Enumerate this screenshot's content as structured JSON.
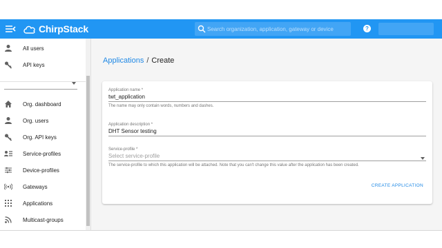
{
  "colors": {
    "appbar": "#2196f3",
    "link": "#1e88e5"
  },
  "topbar": {
    "logo_text": "ChirpStack",
    "search_placeholder": "Search organization, application, gateway or device",
    "help_glyph": "?"
  },
  "sidebar": {
    "top_items": [
      {
        "label": "All users",
        "icon": "person-icon"
      },
      {
        "label": "API keys",
        "icon": "key-icon"
      }
    ],
    "org_items": [
      {
        "label": "Org. dashboard",
        "icon": "home-icon"
      },
      {
        "label": "Org. users",
        "icon": "person-icon"
      },
      {
        "label": "Org. API keys",
        "icon": "key-icon"
      },
      {
        "label": "Service-profiles",
        "icon": "account-details-icon"
      },
      {
        "label": "Device-profiles",
        "icon": "tune-icon"
      },
      {
        "label": "Gateways",
        "icon": "radio-tower-icon"
      },
      {
        "label": "Applications",
        "icon": "apps-grid-icon"
      },
      {
        "label": "Multicast-groups",
        "icon": "rss-icon"
      }
    ]
  },
  "breadcrumb": {
    "parent": "Applications",
    "separator": "/",
    "current": "Create"
  },
  "form": {
    "name": {
      "label": "Application name *",
      "value": "twt_application",
      "help": "The name may only contain words, numbers and dashes."
    },
    "description": {
      "label": "Application description *",
      "value": "DHT Sensor testing"
    },
    "service_profile": {
      "label": "Service-profile *",
      "placeholder": "Select service-profile",
      "help": "The service-profile to which this application will be attached. Note that you can't change this value after the application has been created."
    },
    "submit_label": "CREATE APPLICATION"
  }
}
